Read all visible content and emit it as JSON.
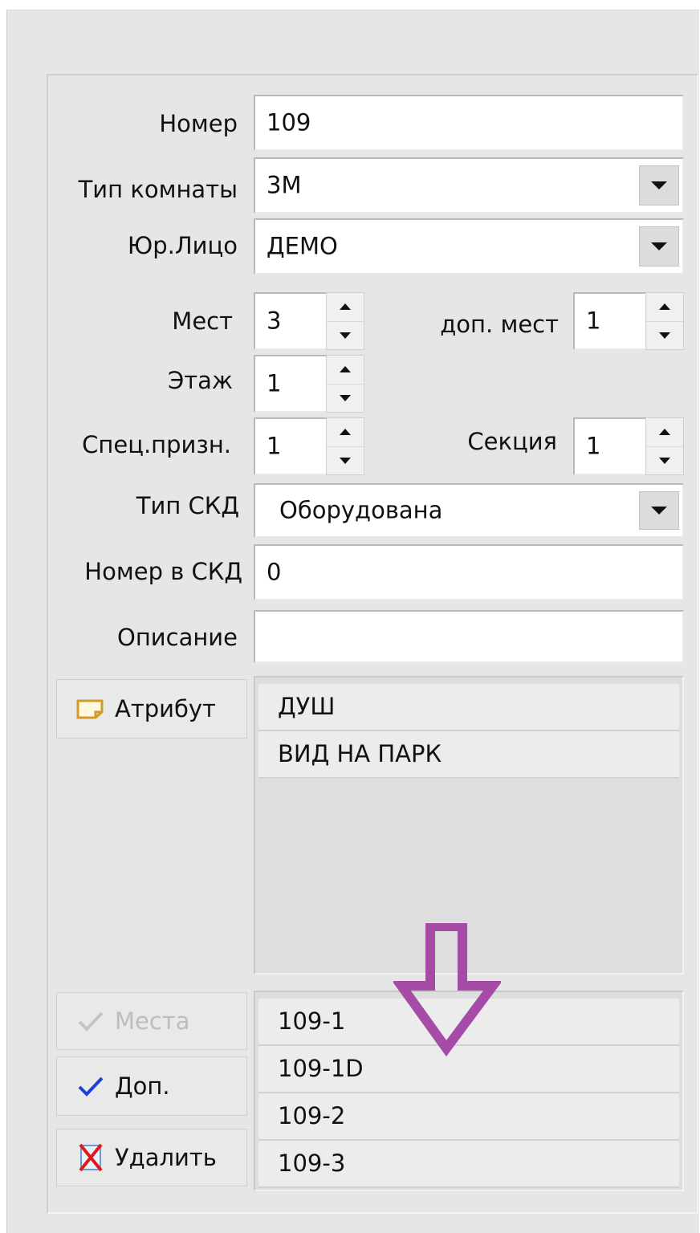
{
  "form": {
    "number_label": "Номер",
    "number_value": "109",
    "room_type_label": "Тип комнаты",
    "room_type_value": "3М",
    "legal_entity_label": "Юр.Лицо",
    "legal_entity_value": "ДЕМО",
    "places_label": "Мест",
    "places_value": "3",
    "extra_places_label": "доп. мест",
    "extra_places_value": "1",
    "floor_label": "Этаж",
    "floor_value": "1",
    "special_label": "Спец.призн.",
    "special_value": "1",
    "section_label": "Секция",
    "section_value": "1",
    "skd_type_label": "Тип СКД",
    "skd_type_value": "Оборудована",
    "skd_number_label": "Номер в СКД",
    "skd_number_value": "0",
    "description_label": "Описание",
    "description_value": ""
  },
  "attributes": {
    "button_label": "Атрибут",
    "items": [
      "ДУШ",
      "ВИД НА ПАРК"
    ]
  },
  "places": {
    "places_button_label": "Места",
    "extra_button_label": "Доп.",
    "delete_button_label": "Удалить",
    "items": [
      "109-1",
      "109-1D",
      "109-2",
      "109-3"
    ]
  },
  "icons": {
    "attribute": "note-icon",
    "places": "check-icon",
    "extra": "check-icon",
    "delete": "delete-x-icon",
    "overlay": "down-arrow-annotation",
    "arrow_color": "#a64ca6"
  }
}
